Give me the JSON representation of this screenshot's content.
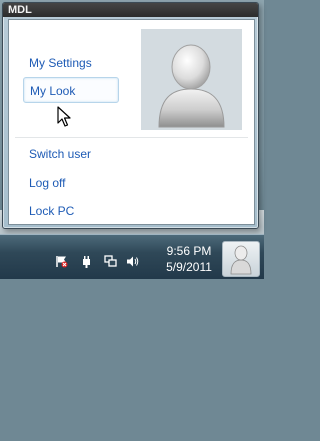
{
  "popup": {
    "title": "MDL",
    "menu_items": [
      {
        "label": "My Settings"
      },
      {
        "label": "My Look"
      },
      {
        "label": "Switch user"
      },
      {
        "label": "Log off"
      },
      {
        "label": "Lock PC"
      }
    ],
    "hovered_item": "My Look"
  },
  "taskbar": {
    "clock_time": "9:56 PM",
    "clock_date": "5/9/2011",
    "tray_icons": [
      "action-center-flag-icon",
      "power-plug-icon",
      "network-icon",
      "volume-icon"
    ],
    "user_tile_icon": "user-avatar-icon"
  },
  "colors": {
    "link_blue": "#1e5bb5",
    "title_bar": "#2c2c2c",
    "taskbar": "#2f4858"
  }
}
